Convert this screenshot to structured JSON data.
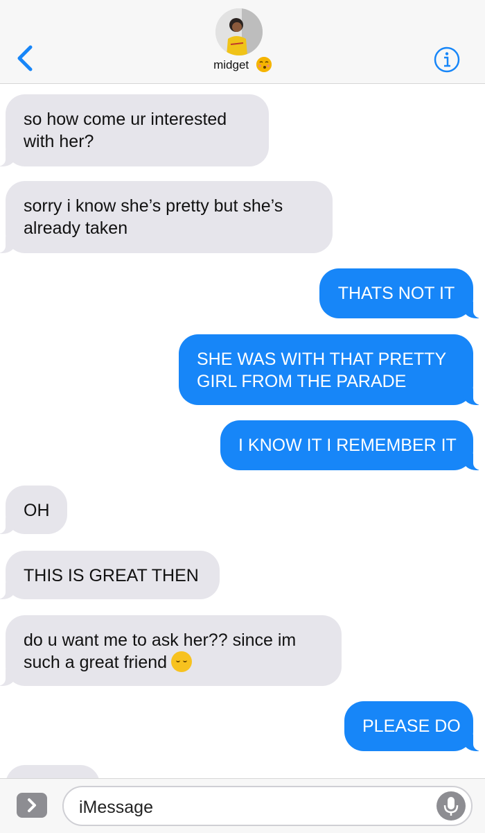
{
  "header": {
    "contact_name": "midget",
    "contact_emoji": "kissing-face-emoji",
    "back_icon": "chevron-left-icon",
    "info_icon": "info-icon"
  },
  "messages": [
    {
      "dir": "in",
      "lines": [
        "so how come ur interested",
        "with her?"
      ]
    },
    {
      "dir": "in",
      "lines": [
        "sorry i know she’s pretty but she’s",
        "already taken"
      ]
    },
    {
      "dir": "out",
      "lines": [
        "THATS NOT IT"
      ]
    },
    {
      "dir": "out",
      "lines": [
        "SHE WAS WITH THAT PRETTY",
        "GIRL FROM THE PARADE"
      ]
    },
    {
      "dir": "out",
      "lines": [
        "I KNOW IT I REMEMBER IT"
      ]
    },
    {
      "dir": "in",
      "lines": [
        "OH"
      ]
    },
    {
      "dir": "in",
      "lines": [
        "THIS IS GREAT THEN"
      ]
    },
    {
      "dir": "in",
      "lines": [
        "do u want me to ask her?? since im",
        "such a great friend"
      ],
      "emoji": "relieved-face-emoji"
    },
    {
      "dir": "out",
      "lines": [
        "PLEASE DO"
      ]
    }
  ],
  "composer": {
    "placeholder": "iMessage",
    "apps_icon": "chevron-right-icon",
    "mic_icon": "microphone-icon"
  },
  "colors": {
    "incoming_bubble": "#e6e5eb",
    "outgoing_bubble": "#1786f8",
    "accent": "#1786f8"
  }
}
